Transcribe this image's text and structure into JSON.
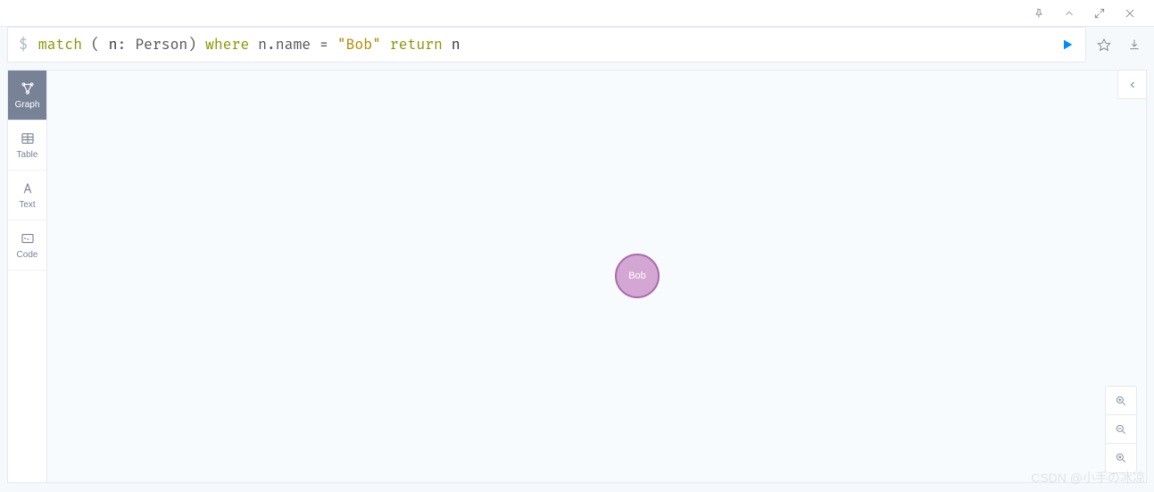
{
  "topbar": {
    "actions": {
      "pin": "pin",
      "collapse": "collapse",
      "expand": "expand",
      "close": "close"
    }
  },
  "query": {
    "prompt": "$",
    "tokens": {
      "match": "match",
      "lparen": " ( ",
      "var": "n",
      "colon": ": ",
      "label": "Person",
      "rparen": ") ",
      "where": "where",
      "sp1": " ",
      "prop": "n.name",
      "eq": " = ",
      "str": "\"Bob\"",
      "sp2": " ",
      "return": "return",
      "sp3": " ",
      "retvar": "n"
    }
  },
  "actions": {
    "run": "run",
    "favorite": "favorite",
    "download": "download"
  },
  "viewTabs": [
    {
      "key": "graph",
      "label": "Graph",
      "active": true
    },
    {
      "key": "table",
      "label": "Table",
      "active": false
    },
    {
      "key": "text",
      "label": "Text",
      "active": false
    },
    {
      "key": "code",
      "label": "Code",
      "active": false
    }
  ],
  "graph": {
    "nodes": [
      {
        "id": "bob",
        "label": "Bob",
        "color": "#d4a6d4",
        "border": "#a86ba8"
      }
    ]
  },
  "zoom": {
    "in": "zoom-in",
    "out": "zoom-out",
    "fit": "fit"
  },
  "collapsePanel": "collapse-detail",
  "watermark": "CSDN @小手の冰凉"
}
